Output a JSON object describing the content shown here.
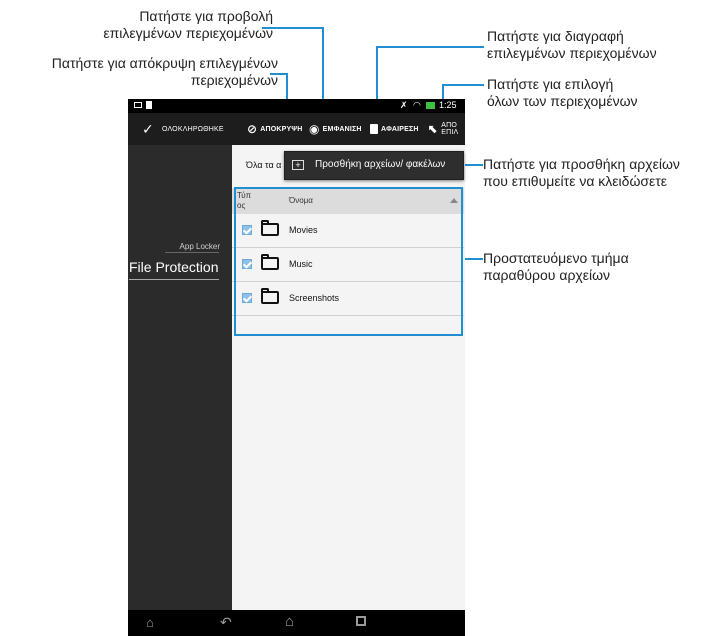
{
  "callouts": {
    "view_selected": [
      "Πατήστε για προβολή",
      "επιλεγμένων περιεχομένων"
    ],
    "hide_selected": [
      "Πατήστε για απόκρυψη επιλεγμένων",
      "περιεχομένων"
    ],
    "delete_selected": [
      "Πατήστε για διαγραφή",
      "επιλεγμένων περιεχομένων"
    ],
    "select_all": [
      "Πατήστε για επιλογή",
      "όλων των περιεχομένων"
    ],
    "add_files": [
      "Πατήστε για προσθήκη αρχείων",
      "που επιθυμείτε να κλειδώσετε"
    ],
    "protected_pane": [
      "Προστατευόμενο τμήμα",
      "παραθύρου αρχείων"
    ]
  },
  "colors": {
    "callout_line": "#1f8fcf",
    "action_bar": "#1d1d1d",
    "sidebar": "#2b2b2b",
    "content_bg": "#f4f4f4",
    "checkbox": "#8fc1e8"
  },
  "statusbar": {
    "time": "1:25"
  },
  "actionbar": {
    "done": "ΟΛΟΚΛΗΡΩΘΗΚΕ",
    "hide": "ΑΠΟΚΡΥΨΗ",
    "show": "ΕΜΦΑΝΙΣΗ",
    "delete": "ΑΦΑΙΡΕΣΗ",
    "deselect_line1": "ΑΠΟ",
    "deselect_line2": "ΕΠΙΛ"
  },
  "sidebar": {
    "section": "App Locker",
    "item": "File Protection"
  },
  "content": {
    "filter_label": "Όλα τα α",
    "popup_label": "Προσθήκη αρχείων/ φακέλων",
    "table": {
      "col_type_line1": "Τύπ",
      "col_type_line2": "ος",
      "col_name": "Όνομα",
      "rows": [
        "Movies",
        "Music",
        "Screenshots"
      ]
    }
  },
  "navbar": {
    "icons": [
      "recent-apps-up-icon",
      "back-icon",
      "home-icon",
      "recent-apps-icon"
    ]
  }
}
